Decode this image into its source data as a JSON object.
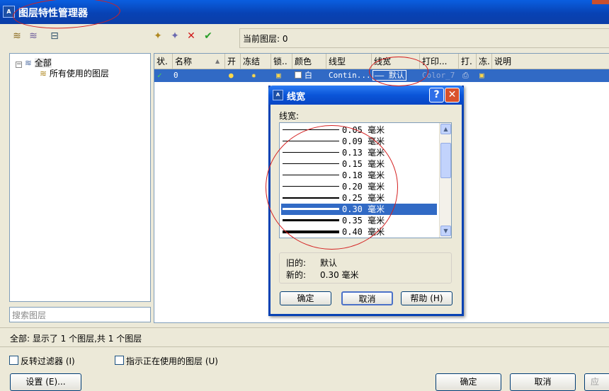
{
  "window": {
    "title": "图层特性管理器",
    "app_icon": "A"
  },
  "toolbar": {
    "left_icons": [
      "new-property-filter-icon",
      "new-group-filter-icon",
      "layer-states-manager-icon"
    ],
    "right_icons": [
      "new-layer-icon",
      "new-layer-vp-frozen-icon",
      "delete-layer-icon",
      "set-current-icon"
    ],
    "current_layer_label": "当前图层: 0"
  },
  "tree": {
    "root": "全部",
    "child": "所有使用的图层"
  },
  "search_placeholder": "搜索图层",
  "list": {
    "columns": [
      "状.",
      "名称",
      "开",
      "冻结",
      "锁..",
      "颜色",
      "线型",
      "线宽",
      "打印...",
      "打.",
      "冻.",
      "说明"
    ],
    "row": {
      "status": "✓",
      "name": "0",
      "color": "白",
      "linetype": "Contin...",
      "lineweight": "—— 默认",
      "plotstyle": "Color_7"
    }
  },
  "status_text": "全部: 显示了 1 个图层,共 1 个图层",
  "footer": {
    "invert_filter": "反转过滤器 (I)",
    "indicate_in_use": "指示正在使用的图层 (U)",
    "settings_btn": "设置 (E)...",
    "ok": "确定",
    "cancel": "取消",
    "apply": "应"
  },
  "dialog": {
    "title": "线宽",
    "help_glyph": "?",
    "close_glyph": "✕",
    "label": "线宽:",
    "items": [
      {
        "value": "0.05 毫米",
        "selected": false
      },
      {
        "value": "0.09 毫米",
        "selected": false
      },
      {
        "value": "0.13 毫米",
        "selected": false
      },
      {
        "value": "0.15 毫米",
        "selected": false
      },
      {
        "value": "0.18 毫米",
        "selected": false
      },
      {
        "value": "0.20 毫米",
        "selected": false
      },
      {
        "value": "0.25 毫米",
        "selected": false
      },
      {
        "value": "0.30 毫米",
        "selected": true
      },
      {
        "value": "0.35 毫米",
        "selected": false
      },
      {
        "value": "0.40 毫米",
        "selected": false
      }
    ],
    "old_label": "旧的:",
    "old_value": "默认",
    "new_label": "新的:",
    "new_value": "0.30 毫米",
    "ok": "确定",
    "cancel": "取消",
    "help": "帮助 (H)"
  },
  "colors": {
    "selection": "#316ac5",
    "annotation": "#d42020",
    "titlebar": "#0842b4"
  }
}
